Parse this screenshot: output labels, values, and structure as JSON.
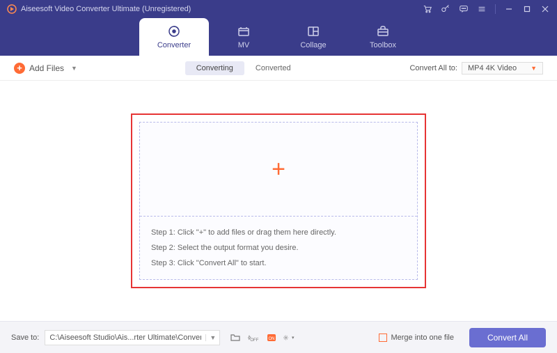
{
  "titlebar": {
    "title": "Aiseesoft Video Converter Ultimate (Unregistered)"
  },
  "nav": {
    "tabs": [
      {
        "label": "Converter"
      },
      {
        "label": "MV"
      },
      {
        "label": "Collage"
      },
      {
        "label": "Toolbox"
      }
    ]
  },
  "toolbar": {
    "add_files_label": "Add Files",
    "segments": {
      "converting": "Converting",
      "converted": "Converted"
    },
    "convert_all_to_label": "Convert All to:",
    "format_selected": "MP4 4K Video"
  },
  "dropzone": {
    "step1": "Step 1: Click \"+\" to add files or drag them here directly.",
    "step2": "Step 2: Select the output format you desire.",
    "step3": "Step 3: Click \"Convert All\" to start."
  },
  "bottombar": {
    "save_to_label": "Save to:",
    "save_path": "C:\\Aiseesoft Studio\\Ais...rter Ultimate\\Converted",
    "merge_label": "Merge into one file",
    "convert_all_button": "Convert All"
  }
}
